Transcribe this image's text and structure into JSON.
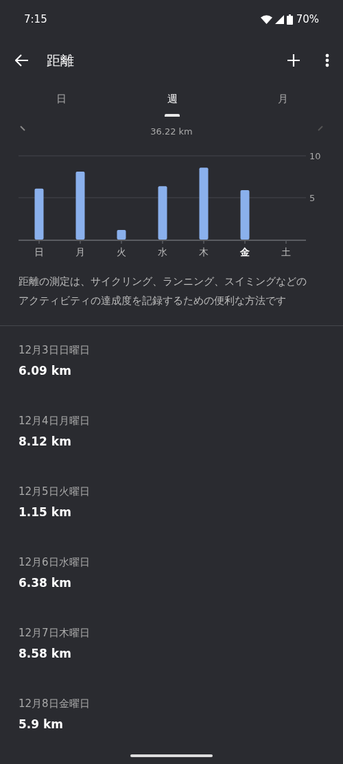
{
  "status_bar": {
    "time": "7:15",
    "battery": "70%"
  },
  "app_bar": {
    "title": "距離"
  },
  "tabs": [
    {
      "label": "日",
      "selected": false
    },
    {
      "label": "週",
      "selected": true
    },
    {
      "label": "月",
      "selected": false
    }
  ],
  "period_total": "36.22 km",
  "chart": {
    "chart_data": {
      "type": "bar",
      "categories": [
        "日",
        "月",
        "火",
        "水",
        "木",
        "金",
        "土"
      ],
      "values": [
        6.09,
        8.12,
        1.15,
        6.38,
        8.58,
        5.9,
        null
      ],
      "ylim": [
        0,
        10
      ],
      "yticks": [
        5,
        10
      ]
    },
    "days": [
      {
        "selected": false
      },
      {
        "selected": false
      },
      {
        "selected": false
      },
      {
        "selected": false
      },
      {
        "selected": false
      },
      {
        "selected": true
      },
      {
        "selected": false
      }
    ]
  },
  "description": "距離の測定は、サイクリング、ランニング、スイミングなどのアクティビティの達成度を記録するための便利な方法です",
  "entries": [
    {
      "date": "12月3日日曜日",
      "value": "6.09 km"
    },
    {
      "date": "12月4日月曜日",
      "value": "8.12 km"
    },
    {
      "date": "12月5日火曜日",
      "value": "1.15 km"
    },
    {
      "date": "12月6日水曜日",
      "value": "6.38 km"
    },
    {
      "date": "12月7日木曜日",
      "value": "8.58 km"
    },
    {
      "date": "12月8日金曜日",
      "value": "5.9 km"
    }
  ]
}
